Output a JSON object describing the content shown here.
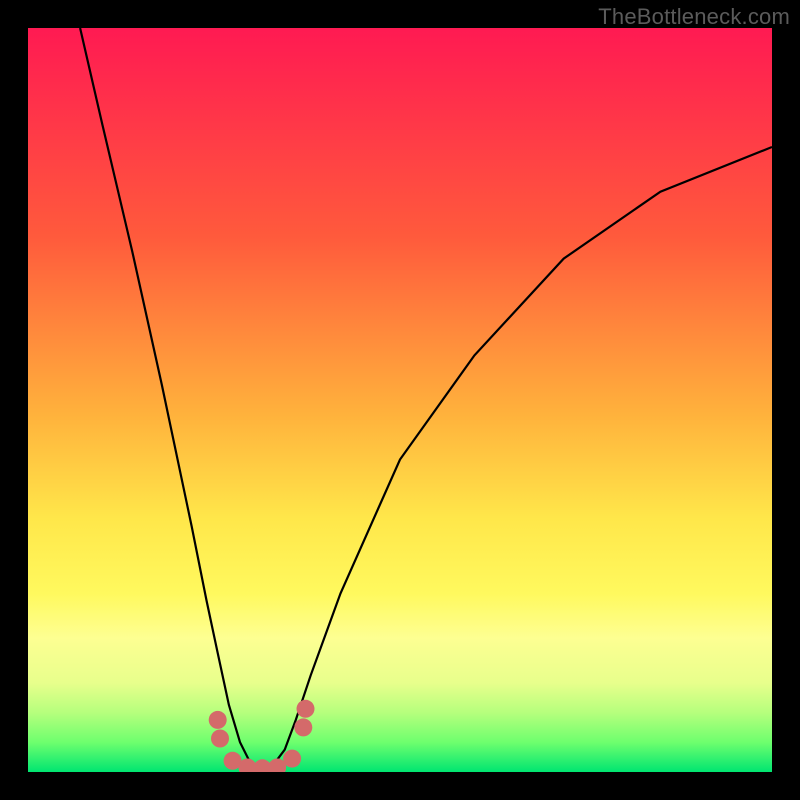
{
  "watermark": "TheBottleneck.com",
  "colors": {
    "background": "#000000",
    "curve": "#000000",
    "markers": "#d46a6a",
    "gradient_top": "#ff1a52",
    "gradient_bottom": "#00e571"
  },
  "chart_data": {
    "type": "line",
    "title": "",
    "xlabel": "",
    "ylabel": "",
    "xlim": [
      0,
      100
    ],
    "ylim": [
      0,
      100
    ],
    "grid": false,
    "note": "No numeric axes are shown; x and y are normalized 0–100. Curve is a V-shaped bottleneck profile reaching ~0 near x≈31 and rising on both sides.",
    "series": [
      {
        "name": "bottleneck-curve",
        "x": [
          7,
          10,
          14,
          18,
          22,
          24,
          25.5,
          27,
          28.5,
          30,
          31.5,
          33,
          34.5,
          36,
          38,
          42,
          50,
          60,
          72,
          85,
          100
        ],
        "y": [
          100,
          87,
          70,
          52,
          33,
          23,
          16,
          9,
          4,
          1,
          0.5,
          1,
          3,
          7,
          13,
          24,
          42,
          56,
          69,
          78,
          84
        ]
      }
    ],
    "markers": {
      "name": "highlight-dots",
      "points": [
        {
          "x": 25.5,
          "y": 7
        },
        {
          "x": 25.8,
          "y": 4.5
        },
        {
          "x": 27.5,
          "y": 1.5
        },
        {
          "x": 29.5,
          "y": 0.6
        },
        {
          "x": 31.5,
          "y": 0.5
        },
        {
          "x": 33.5,
          "y": 0.6
        },
        {
          "x": 35.5,
          "y": 1.8
        },
        {
          "x": 37.0,
          "y": 6
        },
        {
          "x": 37.3,
          "y": 8.5
        }
      ],
      "radius": 9
    }
  }
}
